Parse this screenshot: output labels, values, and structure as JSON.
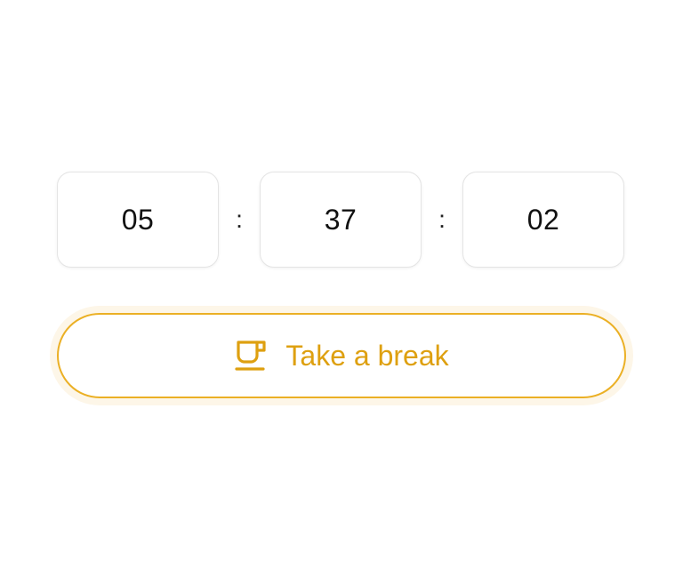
{
  "timer": {
    "hours": "05",
    "minutes": "37",
    "seconds": "02",
    "separator": ":"
  },
  "break_button": {
    "label": "Take a break",
    "icon": "coffee-cup-icon"
  },
  "colors": {
    "accent": "#ebb025",
    "accent_text": "#dea010",
    "accent_halo": "#fdf6e8",
    "box_border": "#e4e4e4"
  }
}
